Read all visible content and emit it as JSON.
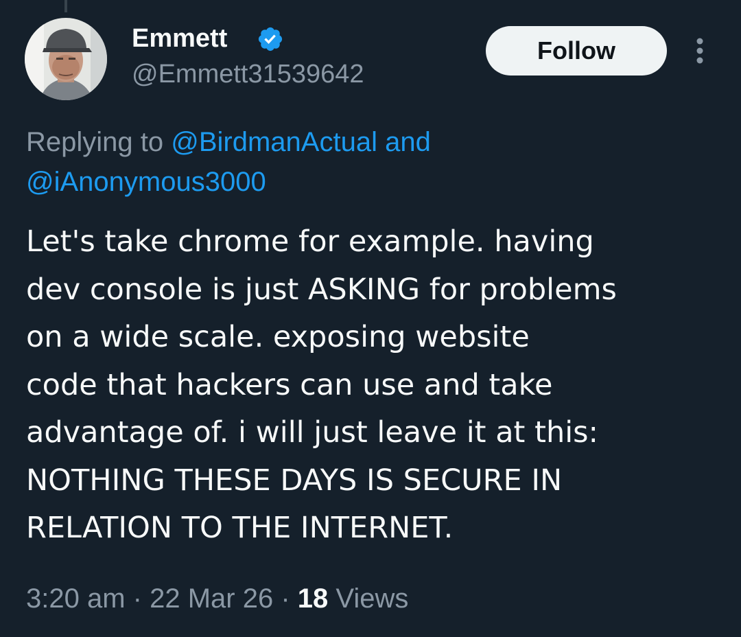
{
  "author": {
    "display_name": "Emmett",
    "handle": "@Emmett31539642",
    "verified_color": "#1d9bf0"
  },
  "actions": {
    "follow_label": "Follow",
    "more_icon": "more-vertical-icon"
  },
  "reply_context": {
    "prefix": "Replying to",
    "mention1": "@BirdmanActual",
    "conjunction": "and",
    "mention2": "@iAnonymous3000"
  },
  "tweet": {
    "lines": [
      "Let's take chrome for example. having",
      "dev console is just ASKING for problems",
      "on a wide scale. exposing website",
      "code that hackers can use and take",
      "advantage of. i will just leave it at this:",
      "NOTHING THESE DAYS IS SECURE IN",
      "RELATION TO THE INTERNET."
    ]
  },
  "meta": {
    "time": "3:20 am",
    "date": "22 Mar 26",
    "separator": "·",
    "views_count": "18",
    "views_label": "Views"
  },
  "colors": {
    "background": "#15202b",
    "text": "#f7f9f9",
    "secondary": "#8b98a5",
    "link": "#1d9bf0",
    "button_bg": "#eff3f4"
  }
}
